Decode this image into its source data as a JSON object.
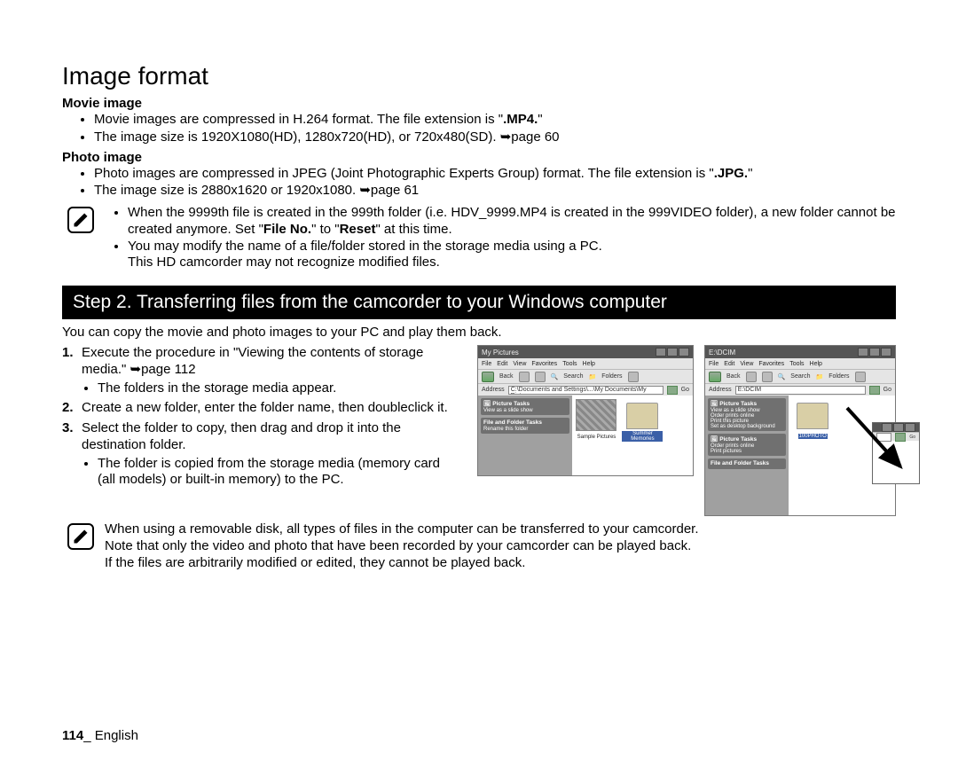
{
  "title": "Image format",
  "movie": {
    "heading": "Movie image",
    "b1a": "Movie images are compressed in H.264 format. The file extension is \"",
    "b1b": ".MP4.",
    "b1c": "\"",
    "b2": "The image size is 1920X1080(HD), 1280x720(HD), or 720x480(SD). ➥page 60"
  },
  "photo": {
    "heading": "Photo image",
    "b1a": "Photo images are compressed in JPEG (Joint Photographic Experts Group) format. The file extension is \"",
    "b1b": ".JPG.",
    "b1c": "\"",
    "b2": "The image size is 2880x1620 or 1920x1080. ➥page 61"
  },
  "note1": {
    "l1a": "When the 9999th file is created in the 999th folder (i.e. HDV_9999.MP4 is created in the 999VIDEO folder), a new folder cannot be created anymore. Set \"",
    "l1b": "File No.",
    "l1c": "\" to \"",
    "l1d": "Reset",
    "l1e": "\" at this time.",
    "l2": "You may modify the name of a file/folder stored in the storage media using a PC.",
    "l2b": "This HD camcorder may not recognize modified files."
  },
  "step2_bar": "Step 2. Transferring files from the camcorder to your Windows computer",
  "intro": "You can copy the movie and photo images to your PC and play them back.",
  "steps": {
    "s1": "Execute the procedure in \"Viewing the contents of storage media.\" ➥page 112",
    "s1b": "The folders in the storage media appear.",
    "s2": "Create a new folder, enter the folder name, then doubleclick it.",
    "s3": "Select the folder to copy, then drag and drop it into the destination folder.",
    "s3b": "The folder is copied from the storage media (memory card (all models) or built-in memory) to the PC."
  },
  "note2": {
    "l1": "When using a removable disk, all types of files in the computer can be transferred to your camcorder.",
    "l2": "Note that only the video and photo that have been recorded by your camcorder can be played back.",
    "l3": "If the files are arbitrarily modified or edited, they cannot be played back."
  },
  "figA": {
    "title": "My Pictures",
    "menu": [
      "File",
      "Edit",
      "View",
      "Favorites",
      "Tools",
      "Help"
    ],
    "toolbar": {
      "back": "Back",
      "search": "Search",
      "folders": "Folders"
    },
    "address_label": "Address",
    "address": "C:\\Documents and Settings\\...\\My Documents\\My Pictures",
    "go": "Go",
    "panelA": "Picture Tasks",
    "panelA_i1": "View as a slide show",
    "panelB": "File and Folder Tasks",
    "panelB_i1": "Rename this folder",
    "thumb1": "Sample Pictures",
    "thumb2": "Summer Memories"
  },
  "figB": {
    "title": "E:\\DCIM",
    "menu": [
      "File",
      "Edit",
      "View",
      "Favorites",
      "Tools",
      "Help"
    ],
    "toolbar": {
      "back": "Back",
      "search": "Search",
      "folders": "Folders"
    },
    "address_label": "Address",
    "address": "E:\\DCIM",
    "go": "Go",
    "panelA": "Picture Tasks",
    "panelA_i1": "View as a slide show",
    "panelA_i2": "Order prints online",
    "panelA_i3": "Print this picture",
    "panelA_i4": "Set as desktop background",
    "panelB": "Picture Tasks",
    "panelB_i1": "Order prints online",
    "panelB_i2": "Print pictures",
    "panelC": "File and Folder Tasks",
    "thumb1": "100PHOTO"
  },
  "footer": {
    "page": "114",
    "sep": "_ ",
    "lang": "English"
  }
}
